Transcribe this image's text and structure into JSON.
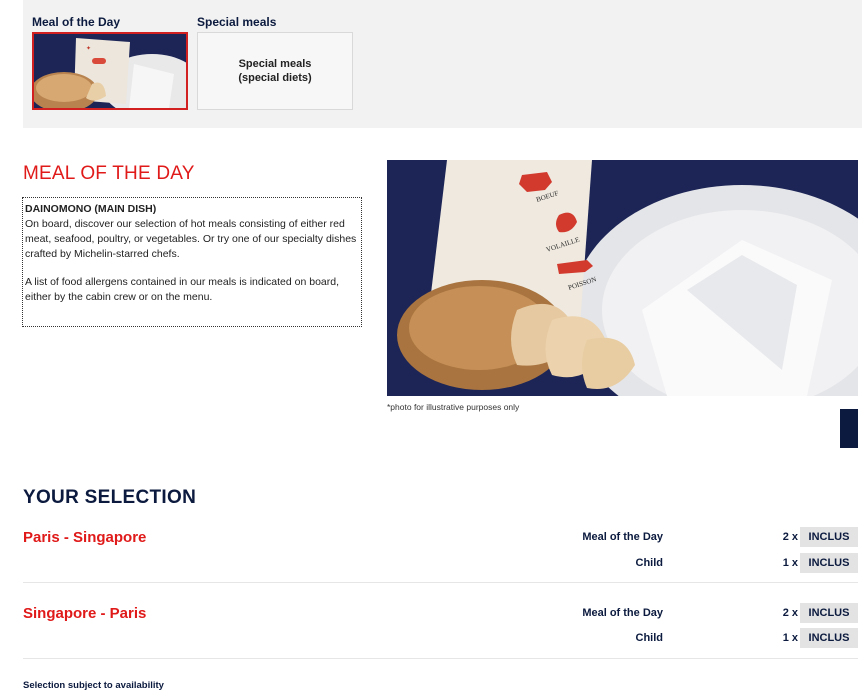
{
  "tabs": {
    "meal_of_the_day": {
      "label": "Meal of the Day"
    },
    "special_meals": {
      "label": "Special meals",
      "card_text": "Special meals\n(special diets)"
    }
  },
  "meal_section": {
    "title": "MEAL OF THE DAY",
    "dish_title": "DAINOMONO (MAIN DISH)",
    "description": "On board, discover our selection of hot meals consisting of either red meat, seafood, poultry, or vegetables. Or try one of our specialty dishes crafted by Michelin-starred chefs.",
    "allergen_note": "A list of food allergens contained in our meals is indicated on board, either by the cabin crew or on the menu.",
    "photo_caption": "*photo for illustrative purposes only",
    "menu_card": {
      "item1": "BOEUF",
      "item2": "VOLAILLE",
      "item3": "POISSON"
    }
  },
  "selection": {
    "title": "YOUR SELECTION",
    "routes": [
      {
        "name": "Paris - Singapore",
        "items": [
          {
            "meal": "Meal of the Day",
            "qty": "2 x",
            "status": "INCLUS"
          },
          {
            "meal": "Child",
            "qty": "1 x",
            "status": "INCLUS"
          }
        ]
      },
      {
        "name": "Singapore - Paris",
        "items": [
          {
            "meal": "Meal of the Day",
            "qty": "2 x",
            "status": "INCLUS"
          },
          {
            "meal": "Child",
            "qty": "1 x",
            "status": "INCLUS"
          }
        ]
      }
    ],
    "footnote": "Selection subject to availability"
  },
  "colors": {
    "accent": "#e01919",
    "navy": "#0b1a3e",
    "photo_bg": "#1c2556",
    "badge_bg": "#e3e3e3"
  }
}
